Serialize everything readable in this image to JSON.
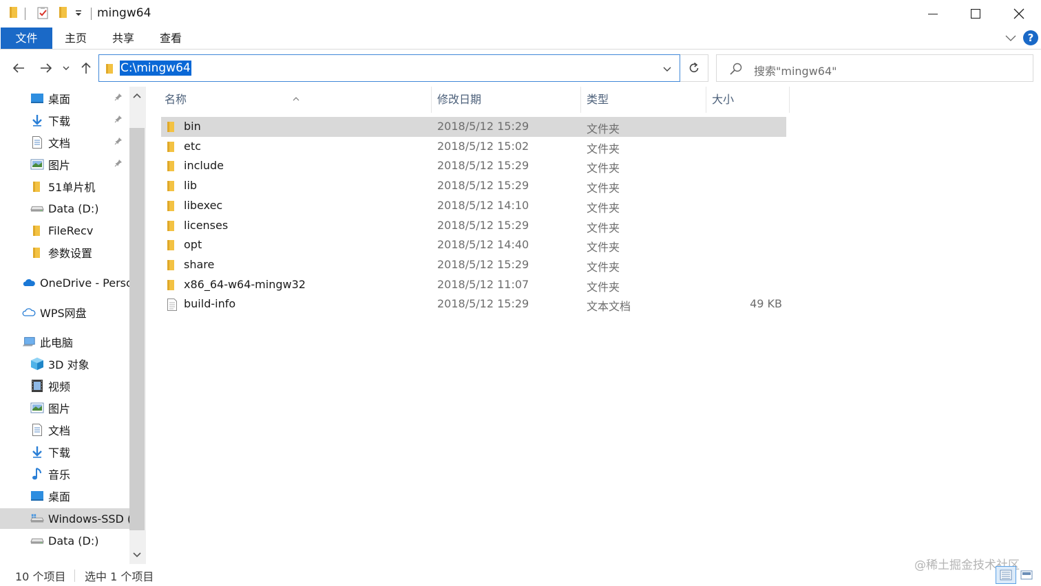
{
  "window": {
    "title": "mingw64"
  },
  "ribbon": {
    "tabs": [
      "文件",
      "主页",
      "共享",
      "查看"
    ],
    "help_label": "?"
  },
  "address": {
    "path": "C:\\mingw64"
  },
  "search": {
    "placeholder": "搜索\"mingw64\""
  },
  "nav": {
    "items": [
      {
        "label": "桌面",
        "icon": "desktop-icon",
        "pinned": true
      },
      {
        "label": "下载",
        "icon": "download-icon",
        "pinned": true
      },
      {
        "label": "文档",
        "icon": "document-icon",
        "pinned": true
      },
      {
        "label": "图片",
        "icon": "pictures-icon",
        "pinned": true
      },
      {
        "label": "51单片机",
        "icon": "folder-icon"
      },
      {
        "label": "Data (D:)",
        "icon": "drive-icon"
      },
      {
        "label": "FileRecv",
        "icon": "folder-icon"
      },
      {
        "label": "参数设置",
        "icon": "folder-icon"
      },
      {
        "label": "OneDrive - Perso",
        "icon": "onedrive-icon"
      },
      {
        "label": "WPS网盘",
        "icon": "wps-cloud-icon"
      },
      {
        "label": "此电脑",
        "icon": "this-pc-icon"
      },
      {
        "label": "3D 对象",
        "icon": "3d-objects-icon"
      },
      {
        "label": "视频",
        "icon": "videos-icon"
      },
      {
        "label": "图片",
        "icon": "pictures-icon"
      },
      {
        "label": "文档",
        "icon": "document-icon"
      },
      {
        "label": "下载",
        "icon": "download-icon"
      },
      {
        "label": "音乐",
        "icon": "music-icon"
      },
      {
        "label": "桌面",
        "icon": "desktop-icon"
      },
      {
        "label": "Windows-SSD (",
        "icon": "windows-drive-icon",
        "selected": true
      },
      {
        "label": "Data (D:)",
        "icon": "drive-icon"
      }
    ]
  },
  "columns": {
    "name": "名称",
    "date": "修改日期",
    "type": "类型",
    "size": "大小"
  },
  "files": [
    {
      "name": "bin",
      "date": "2018/5/12 15:29",
      "type": "文件夹",
      "size": "",
      "icon": "folder-icon",
      "selected": true
    },
    {
      "name": "etc",
      "date": "2018/5/12 15:02",
      "type": "文件夹",
      "size": "",
      "icon": "folder-icon"
    },
    {
      "name": "include",
      "date": "2018/5/12 15:29",
      "type": "文件夹",
      "size": "",
      "icon": "folder-icon"
    },
    {
      "name": "lib",
      "date": "2018/5/12 15:29",
      "type": "文件夹",
      "size": "",
      "icon": "folder-icon"
    },
    {
      "name": "libexec",
      "date": "2018/5/12 14:10",
      "type": "文件夹",
      "size": "",
      "icon": "folder-icon"
    },
    {
      "name": "licenses",
      "date": "2018/5/12 15:29",
      "type": "文件夹",
      "size": "",
      "icon": "folder-icon"
    },
    {
      "name": "opt",
      "date": "2018/5/12 14:40",
      "type": "文件夹",
      "size": "",
      "icon": "folder-icon"
    },
    {
      "name": "share",
      "date": "2018/5/12 15:29",
      "type": "文件夹",
      "size": "",
      "icon": "folder-icon"
    },
    {
      "name": "x86_64-w64-mingw32",
      "date": "2018/5/12 11:07",
      "type": "文件夹",
      "size": "",
      "icon": "folder-icon"
    },
    {
      "name": "build-info",
      "date": "2018/5/12 15:29",
      "type": "文本文档",
      "size": "49 KB",
      "icon": "text-file-icon"
    }
  ],
  "status": {
    "item_count": "10 个项目",
    "selected_count": "选中 1 个项目"
  },
  "watermark": "@稀土掘金技术社区",
  "colors": {
    "accent": "#1a69c7",
    "selection": "#d9d9d9",
    "folder": "#f3c243"
  }
}
